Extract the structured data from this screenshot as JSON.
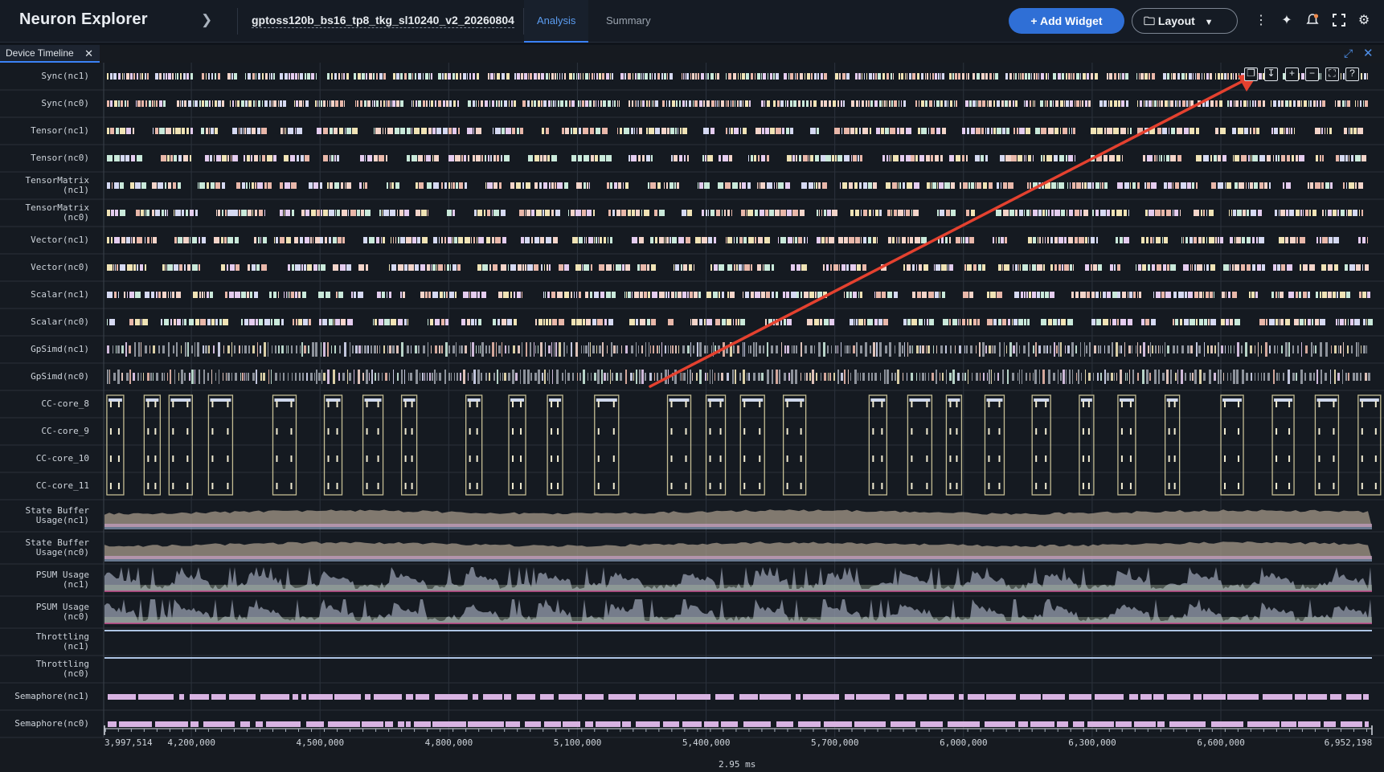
{
  "app": {
    "title": "Neuron Explorer",
    "profile_name": "gptoss120b_bs16_tp8_tkg_sl10240_v2_20260804"
  },
  "tabs": [
    {
      "label": "Analysis",
      "active": true
    },
    {
      "label": "Summary",
      "active": false
    }
  ],
  "toolbar": {
    "add_widget_label": "Add Widget",
    "layout_label": "Layout"
  },
  "panel": {
    "tab_label": "Device Timeline"
  },
  "lanes": [
    {
      "label_line1": "Sync(nc1)",
      "label_line2": "",
      "kind": "events"
    },
    {
      "label_line1": "Sync(nc0)",
      "label_line2": "",
      "kind": "events"
    },
    {
      "label_line1": "Tensor(nc1)",
      "label_line2": "",
      "kind": "events"
    },
    {
      "label_line1": "Tensor(nc0)",
      "label_line2": "",
      "kind": "events"
    },
    {
      "label_line1": "TensorMatrix",
      "label_line2": "(nc1)",
      "kind": "events"
    },
    {
      "label_line1": "TensorMatrix",
      "label_line2": "(nc0)",
      "kind": "events"
    },
    {
      "label_line1": "Vector(nc1)",
      "label_line2": "",
      "kind": "events"
    },
    {
      "label_line1": "Vector(nc0)",
      "label_line2": "",
      "kind": "events"
    },
    {
      "label_line1": "Scalar(nc1)",
      "label_line2": "",
      "kind": "events"
    },
    {
      "label_line1": "Scalar(nc0)",
      "label_line2": "",
      "kind": "events"
    },
    {
      "label_line1": "GpSimd(nc1)",
      "label_line2": "",
      "kind": "gpsimd"
    },
    {
      "label_line1": "GpSimd(nc0)",
      "label_line2": "",
      "kind": "gpsimd"
    },
    {
      "label_line1": "CC-core_8",
      "label_line2": "",
      "kind": "cc"
    },
    {
      "label_line1": "CC-core_9",
      "label_line2": "",
      "kind": "cc"
    },
    {
      "label_line1": "CC-core_10",
      "label_line2": "",
      "kind": "cc"
    },
    {
      "label_line1": "CC-core_11",
      "label_line2": "",
      "kind": "cc"
    },
    {
      "label_line1": "State Buffer",
      "label_line2": "Usage(nc1)",
      "kind": "state"
    },
    {
      "label_line1": "State Buffer",
      "label_line2": "Usage(nc0)",
      "kind": "state"
    },
    {
      "label_line1": "PSUM Usage",
      "label_line2": "(nc1)",
      "kind": "psum"
    },
    {
      "label_line1": "PSUM Usage",
      "label_line2": "(nc0)",
      "kind": "psum"
    },
    {
      "label_line1": "Throttling",
      "label_line2": "(nc1)",
      "kind": "throttle"
    },
    {
      "label_line1": "Throttling",
      "label_line2": "(nc0)",
      "kind": "throttle"
    },
    {
      "label_line1": "Semaphore(nc1)",
      "label_line2": "",
      "kind": "semaphore"
    },
    {
      "label_line1": "Semaphore(nc0)",
      "label_line2": "",
      "kind": "semaphore"
    }
  ],
  "axis": {
    "start": 3997514,
    "end": 6952198,
    "tick_labels": [
      "3,997,514",
      "4,200,000",
      "4,500,000",
      "4,800,000",
      "5,100,000",
      "5,400,000",
      "5,700,000",
      "6,000,000",
      "6,300,000",
      "6,600,000",
      "6,952,198"
    ],
    "tick_values": [
      3997514,
      4200000,
      4500000,
      4800000,
      5100000,
      5400000,
      5700000,
      6000000,
      6300000,
      6600000,
      6952198
    ],
    "duration_label": "2.95 ms"
  },
  "cc_group_times": [
    4003000,
    4090000,
    4148000,
    4240000,
    4390000,
    4510000,
    4600000,
    4690000,
    4840000,
    4940000,
    5030000,
    5140000,
    5310000,
    5400000,
    5480000,
    5580000,
    5780000,
    5870000,
    5960000,
    6050000,
    6160000,
    6270000,
    6360000,
    6470000,
    6600000,
    6720000,
    6820000,
    6920000
  ],
  "mini_toolbar": [
    "duplicate-icon",
    "download-icon",
    "zoom-in-icon",
    "zoom-out-icon",
    "fit-icon",
    "help-icon"
  ],
  "colors": {
    "accent": "#3b82f6",
    "annotation_arrow": "#e4412f",
    "event_palette": [
      "#f3d4c9",
      "#c9e9da",
      "#e4ccef",
      "#f0e3b5",
      "#d5d9f2",
      "#e8b7a9"
    ],
    "cc_border": "#e2d9a7",
    "grid": "#333a44"
  }
}
